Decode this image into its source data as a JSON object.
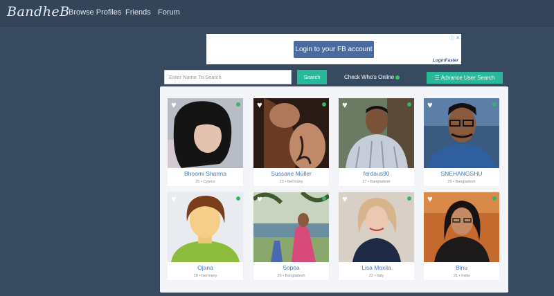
{
  "brand": "BandheB",
  "nav": [
    "Browse Profiles",
    "Friends",
    "Forum"
  ],
  "ad": {
    "button": "Login to your FB account",
    "brand": "LoginFaster",
    "close": "ⓘ ✕"
  },
  "search": {
    "placeholder": "Enter Name To Search",
    "button": "Search"
  },
  "online_label": "Check Who's Online",
  "advanced_label": "Advance User Search",
  "colors": {
    "accent": "#27b99a",
    "online": "#34c759",
    "name": "#3d7cc0"
  },
  "profiles": [
    {
      "name": "Bhoomi Sharma",
      "meta": "25 • Cyprus"
    },
    {
      "name": "Sussane Müller",
      "meta": "23 • Germany"
    },
    {
      "name": "ferdaus90",
      "meta": "27 • Bangladesh"
    },
    {
      "name": "SNEHANGSHU",
      "meta": "26 • Bangladesh"
    },
    {
      "name": "Ojana",
      "meta": "39 • Germany"
    },
    {
      "name": "Sopna",
      "meta": "20 • Bangladesh"
    },
    {
      "name": "Lisa Moxila",
      "meta": "22 • Italy"
    },
    {
      "name": "Binu",
      "meta": "21 • India"
    }
  ]
}
